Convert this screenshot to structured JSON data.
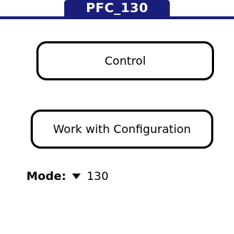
{
  "app": {
    "title": "PFC_130",
    "accent_color": "#1a1e7a"
  },
  "buttons": {
    "control_label": "Control",
    "configuration_label": "Work with Configuration"
  },
  "mode": {
    "label": "Mode:",
    "selected_value": "130",
    "dropdown_icon": "triangle-down-icon"
  }
}
